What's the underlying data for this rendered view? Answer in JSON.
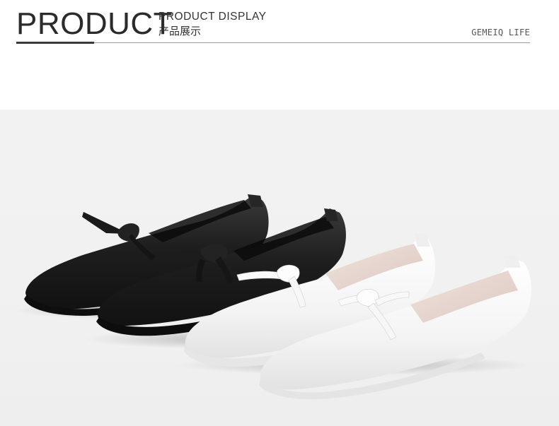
{
  "header": {
    "title": "PRODUCT",
    "subtitle_en": "PRODUCT DISPLAY",
    "subtitle_cn": "产品展示",
    "brand": "GEMEIQ LIFE"
  },
  "colors": {
    "text": "#2b2b2b",
    "rule": "#9a9a9a",
    "photo_background": "#f1f1f1",
    "black_shoe": "#1e1e1e",
    "white_shoe": "#f6f6f6",
    "white_shoe_lining": "#ead9d2"
  },
  "image": {
    "subject": "two pairs of flat loafers with bow detail (black and white)"
  }
}
